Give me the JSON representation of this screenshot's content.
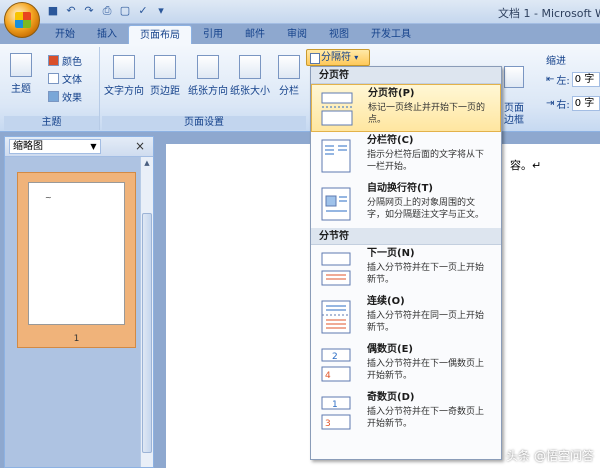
{
  "window": {
    "title": "文档 1 - Microsoft W"
  },
  "qat": [
    "save-icon",
    "undo-icon",
    "redo-icon",
    "print-icon",
    "new-icon",
    "check-icon"
  ],
  "tabs": [
    {
      "label": "开始"
    },
    {
      "label": "插入"
    },
    {
      "label": "页面布局",
      "active": true
    },
    {
      "label": "引用"
    },
    {
      "label": "邮件"
    },
    {
      "label": "审阅"
    },
    {
      "label": "视图"
    },
    {
      "label": "开发工具"
    }
  ],
  "ribbon": {
    "theme_group": {
      "label": "主题",
      "theme_btn": "主题",
      "colors": "颜色",
      "fonts": "文体",
      "effects": "效果"
    },
    "page_setup_group": {
      "label": "页面设置",
      "text_direction": "文字方向",
      "margins": "页边距",
      "orientation": "纸张方向",
      "size": "纸张大小",
      "columns": "分栏",
      "breaks": "分隔符"
    },
    "page_background": {
      "borders": "页面\n边框"
    },
    "paragraph": {
      "indent": "缩进",
      "left_label": "左:",
      "left_value": "0 字",
      "right_label": "右:",
      "right_value": "0 字"
    }
  },
  "pane": {
    "select_value": "缩略图",
    "thumb_page_mark": "~",
    "thumb_page_number": "1"
  },
  "document": {
    "visible_text": "容。↵"
  },
  "menu": {
    "section_page_breaks": "分页符",
    "section_section_breaks": "分节符",
    "items": [
      {
        "title": "分页符(P)",
        "desc": "标记一页终止并开始下一页的\n点。"
      },
      {
        "title": "分栏符(C)",
        "desc": "指示分栏符后面的文字将从下\n一栏开始。"
      },
      {
        "title": "自动换行符(T)",
        "desc": "分隔网页上的对象周围的文\n字，如分隔题注文字与正文。"
      },
      {
        "title": "下一页(N)",
        "desc": "插入分节符并在下一页上开始\n新节。"
      },
      {
        "title": "连续(O)",
        "desc": "插入分节符并在同一页上开始\n新节。"
      },
      {
        "title": "偶数页(E)",
        "desc": "插入分节符并在下一偶数页上\n开始新节。"
      },
      {
        "title": "奇数页(D)",
        "desc": "插入分节符并在下一奇数页上\n开始新节。"
      }
    ]
  },
  "watermark": "头条 @悟空问答"
}
